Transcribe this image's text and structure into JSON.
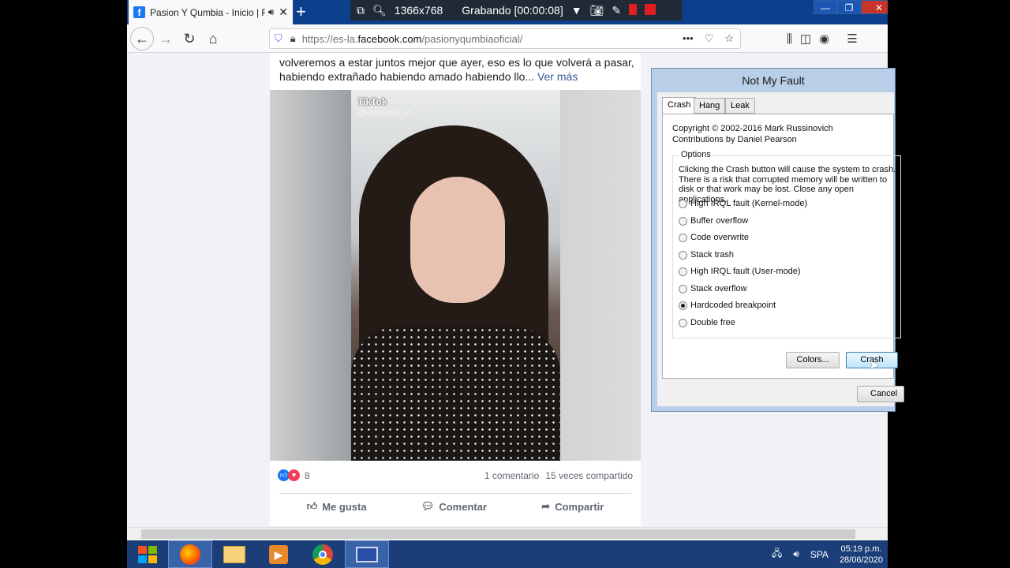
{
  "browser": {
    "tab_title": "Pasion Y Qumbia - Inicio | F",
    "fb_letter": "f",
    "url_prefix": "https://es-la.",
    "url_domain": "facebook.com",
    "url_path": "/pasionyqumbiaoficial/"
  },
  "recorder": {
    "resolution": "1366x768",
    "status": "Grabando [00:00:08]"
  },
  "post": {
    "text": "volveremos a estar juntos mejor que ayer, eso es lo que volverá a pasar, habiendo extrañado habiendo amado habiendo llo...",
    "more": "Ver más",
    "tiktok_brand": "TikTok",
    "tiktok_handle": "@karlasofia_of",
    "reaction_count": "8",
    "comments": "1 comentario",
    "shares": "15 veces compartido",
    "like_label": "Me gusta",
    "comment_label": "Comentar",
    "share_label": "Compartir"
  },
  "dialog": {
    "title": "Not My Fault",
    "tabs": [
      "Crash",
      "Hang",
      "Leak"
    ],
    "copyright": "Copyright © 2002-2016 Mark Russinovich",
    "contributions": "Contributions by Daniel Pearson",
    "options_label": "Options",
    "description": "Clicking the Crash button will cause the system to crash. There is a risk that corrupted memory will be written to disk or that work may be lost. Close any open applications.",
    "options": [
      "High IRQL fault (Kernel-mode)",
      "Buffer overflow",
      "Code overwrite",
      "Stack trash",
      "High IRQL fault (User-mode)",
      "Stack overflow",
      "Hardcoded breakpoint",
      "Double free"
    ],
    "selected_option": "Hardcoded breakpoint",
    "colors_button": "Colors...",
    "crash_button": "Crash",
    "cancel_button": "Cancel"
  },
  "taskbar": {
    "language": "SPA",
    "time": "05:19 p.m.",
    "date": "28/06/2020"
  }
}
